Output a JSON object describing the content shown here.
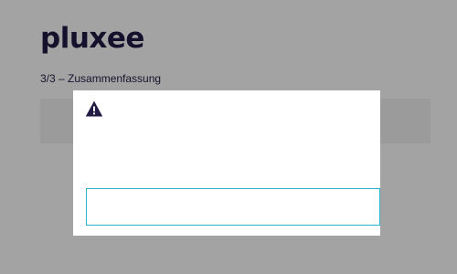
{
  "brand": {
    "logo_text": "pluxee",
    "color": "#221c46"
  },
  "wizard": {
    "step_label": "3/3 – Zusammenfassung"
  },
  "modal": {
    "icon": "warning-icon",
    "input_value": "",
    "input_border_color": "#2bb4cf"
  }
}
